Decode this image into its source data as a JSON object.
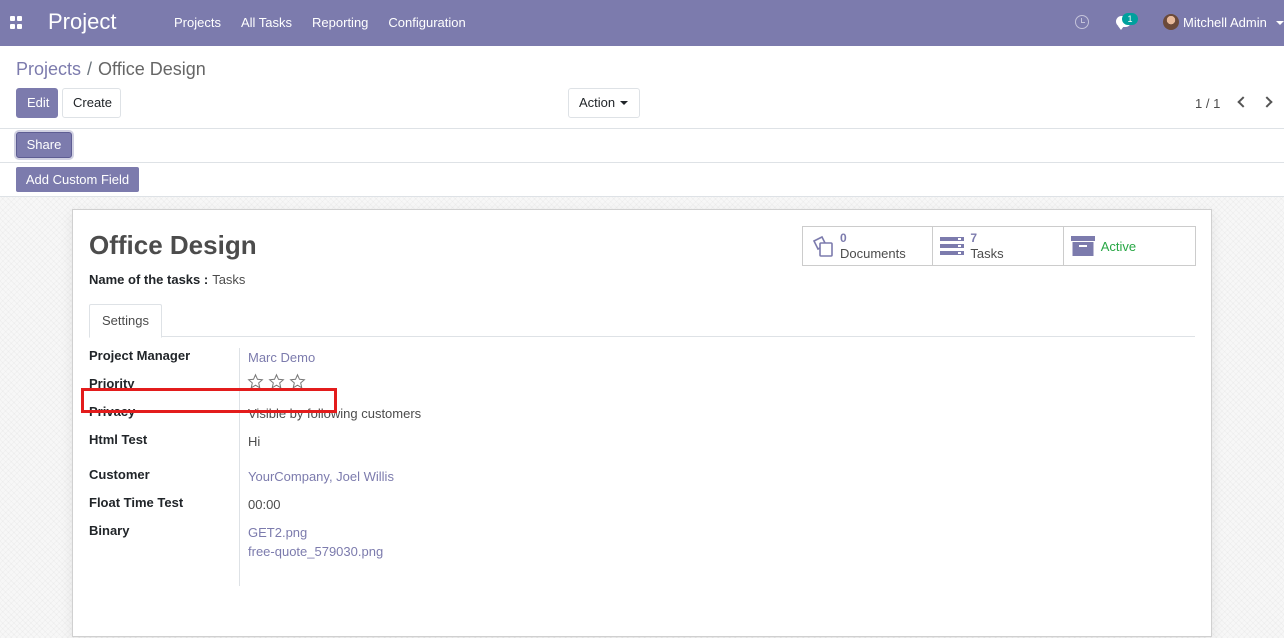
{
  "navbar": {
    "brand": "Project",
    "menu": [
      "Projects",
      "All Tasks",
      "Reporting",
      "Configuration"
    ],
    "chat_count": "1",
    "username": "Mitchell Admin",
    "icons": [
      "apps-icon",
      "clock-icon",
      "chat-icon",
      "avatar"
    ]
  },
  "breadcrumb": {
    "parent": "Projects",
    "separator": "/",
    "current": "Office Design"
  },
  "toolbar": {
    "edit_label": "Edit",
    "create_label": "Create",
    "action_label": "Action",
    "pager": "1 / 1"
  },
  "share_label": "Share",
  "add_custom_field_label": "Add Custom Field",
  "form": {
    "title": "Office Design",
    "task_name_label": "Name of the tasks :",
    "task_name_value": "Tasks",
    "stats": {
      "documents_count": "0",
      "documents_label": "Documents",
      "tasks_count": "7",
      "tasks_label": "Tasks",
      "active_label": "Active"
    },
    "tab_label": "Settings",
    "fields": {
      "project_manager_label": "Project Manager",
      "project_manager_value": "Marc Demo",
      "priority_label": "Priority",
      "priority_stars": 0,
      "privacy_label": "Privacy",
      "privacy_value": "Visible by following customers",
      "html_test_label": "Html Test",
      "html_test_value": "Hi",
      "customer_label": "Customer",
      "customer_value": "YourCompany, Joel Willis",
      "float_time_label": "Float Time Test",
      "float_time_value": "00:00",
      "binary_label": "Binary",
      "binary_files": [
        "GET2.png",
        "free-quote_579030.png"
      ]
    }
  },
  "colors": {
    "brand": "#7c7bad",
    "active": "#28a745",
    "highlight": "#e31c1c"
  }
}
